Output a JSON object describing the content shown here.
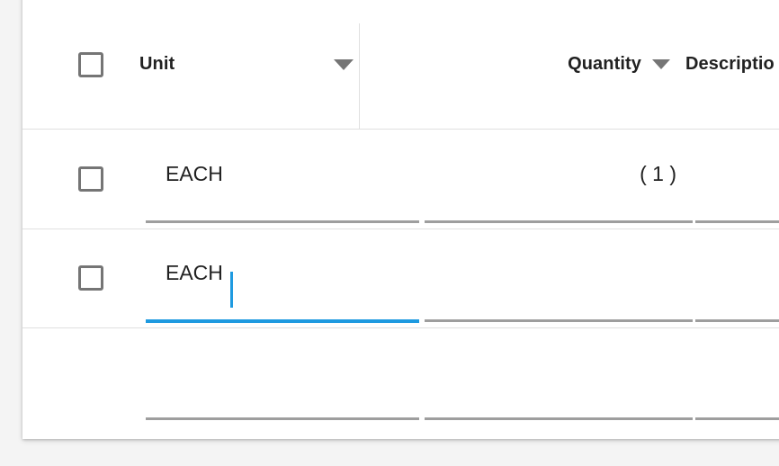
{
  "page": {
    "background_color": "#f4f4f4",
    "card_background": "#ffffff"
  },
  "colors": {
    "accent": "#1e9ae0",
    "text": "#212121",
    "icon": "#757575",
    "divider": "#e0e0e0",
    "field_underline": "#9e9e9e"
  },
  "table": {
    "header": {
      "select_all_checkbox": {
        "icon": "checkbox-unchecked-icon",
        "checked": false
      },
      "columns": [
        {
          "key": "unit",
          "label": "Unit",
          "sortable": true,
          "sort_icon": "chevron-down-icon",
          "align": "left"
        },
        {
          "key": "quantity",
          "label": "Quantity",
          "sortable": true,
          "sort_icon": "chevron-down-icon",
          "align": "right"
        },
        {
          "key": "description",
          "label": "Descriptio",
          "sortable": false,
          "align": "left",
          "truncated": true
        }
      ]
    },
    "rows": [
      {
        "checkbox": {
          "icon": "checkbox-unchecked-icon",
          "checked": false
        },
        "unit": "EACH",
        "quantity": "( 1 )",
        "description": "",
        "focused": false
      },
      {
        "checkbox": {
          "icon": "checkbox-unchecked-icon",
          "checked": false
        },
        "unit": "EACH",
        "quantity": "",
        "description": "",
        "focused": true,
        "focused_field": "unit",
        "caret_visible": true
      },
      {
        "checkbox": null,
        "unit": "",
        "quantity": "",
        "description": "",
        "focused": false
      }
    ]
  }
}
